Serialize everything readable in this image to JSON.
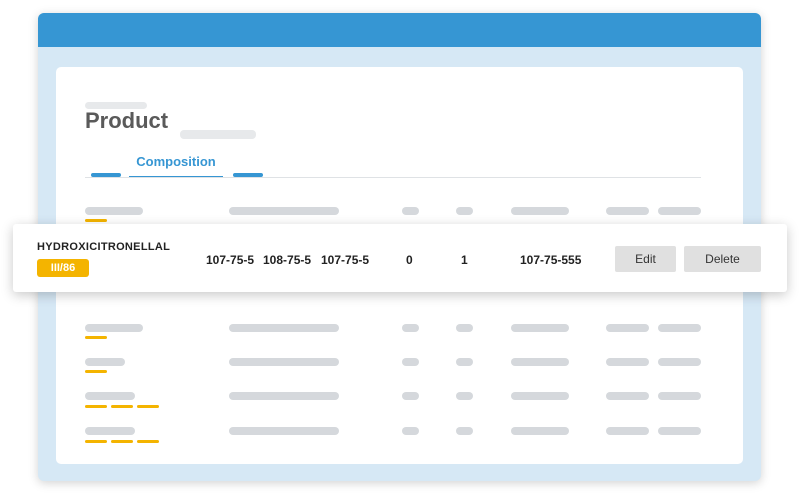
{
  "product": {
    "title": "Product"
  },
  "tabs": {
    "active_label": "Composition"
  },
  "highlighted_row": {
    "name": "HYDROXICITRONELLAL",
    "badge": "III/86",
    "cas_1": "107-75-5",
    "cas_2": "108-75-5",
    "cas_3": "107-75-5",
    "value_a": "0",
    "value_b": "1",
    "cas_main": "107-75-555",
    "edit_label": "Edit",
    "delete_label": "Delete"
  },
  "colors": {
    "titlebar": "#3696d3",
    "accent": "#3696d3",
    "badge": "#f4b400",
    "window_bg": "#d6e8f5",
    "placeholder": "#d5d8dc"
  }
}
